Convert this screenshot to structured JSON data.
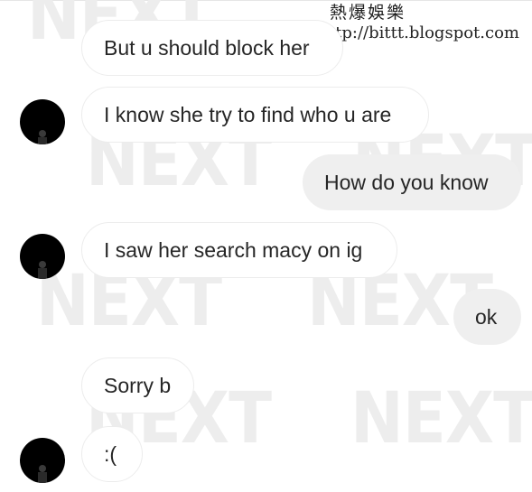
{
  "watermark": {
    "text": "NEXT"
  },
  "brand": {
    "title": "熱爆娛樂",
    "url": "http://bittt.blogspot.com"
  },
  "messages": [
    {
      "direction": "incoming",
      "text": "But u should block her",
      "show_avatar": false
    },
    {
      "direction": "incoming",
      "text": "I know she try to find who u are",
      "show_avatar": true
    },
    {
      "direction": "outgoing",
      "text": "How do you know"
    },
    {
      "direction": "incoming",
      "text": "I saw her search macy on ig",
      "show_avatar": true
    },
    {
      "direction": "outgoing",
      "text": "ok"
    },
    {
      "direction": "incoming",
      "text": "Sorry b",
      "show_avatar": false
    },
    {
      "direction": "incoming",
      "text": ":(",
      "show_avatar": true
    }
  ],
  "colors": {
    "incoming_bubble": "#ffffff",
    "incoming_border": "#ececec",
    "outgoing_bubble": "#efefef",
    "text": "#262626",
    "avatar": "#000000"
  }
}
